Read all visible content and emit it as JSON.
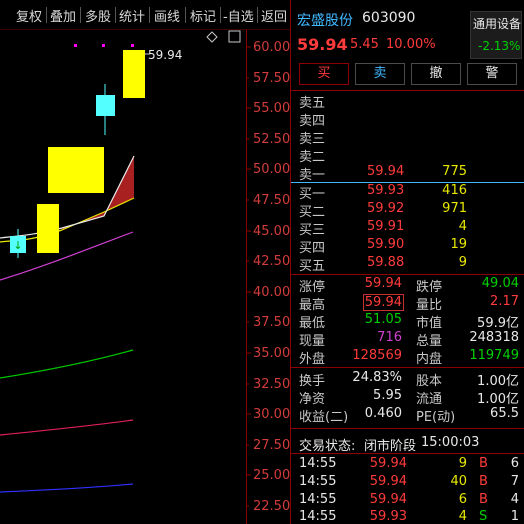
{
  "toolbar": {
    "items": [
      "复权",
      "叠加",
      "多股",
      "统计",
      "画线",
      "标记",
      "-自选",
      "返回"
    ]
  },
  "chart": {
    "y_ticks": [
      "60.00",
      "57.50",
      "55.00",
      "52.50",
      "50.00",
      "47.50",
      "45.00",
      "42.50",
      "40.00",
      "37.50",
      "35.00",
      "32.50",
      "30.00",
      "27.50",
      "25.00",
      "22.50"
    ],
    "last_price_label": "59.94"
  },
  "stock": {
    "name": "宏盛股份",
    "code": "603090",
    "price": "59.94",
    "change": "5.45",
    "change_pct": "10.00%",
    "sector_label": "通用设备",
    "sector_change": "-2.13%"
  },
  "actions": {
    "buy": "买",
    "sell": "卖",
    "cancel": "撤",
    "alert": "警"
  },
  "order_book": {
    "asks": [
      {
        "label": "卖五",
        "price": "",
        "volume": ""
      },
      {
        "label": "卖四",
        "price": "",
        "volume": ""
      },
      {
        "label": "卖三",
        "price": "",
        "volume": ""
      },
      {
        "label": "卖二",
        "price": "",
        "volume": ""
      },
      {
        "label": "卖一",
        "price": "59.94",
        "volume": "775"
      }
    ],
    "bids": [
      {
        "label": "买一",
        "price": "59.93",
        "volume": "416"
      },
      {
        "label": "买二",
        "price": "59.92",
        "volume": "971"
      },
      {
        "label": "买三",
        "price": "59.91",
        "volume": "4"
      },
      {
        "label": "买四",
        "price": "59.90",
        "volume": "19"
      },
      {
        "label": "买五",
        "price": "59.88",
        "volume": "9"
      }
    ]
  },
  "stats": {
    "limit_up_label": "涨停",
    "limit_up": "59.94",
    "limit_down_label": "跌停",
    "limit_down": "49.04",
    "high_label": "最高",
    "high": "59.94",
    "vol_ratio_label": "量比",
    "vol_ratio": "2.17",
    "low_label": "最低",
    "low": "51.05",
    "mkt_cap_label": "市值",
    "mkt_cap": "59.9亿",
    "cur_vol_label": "现量",
    "cur_vol": "716",
    "total_vol_label": "总量",
    "total_vol": "248318",
    "outer_label": "外盘",
    "outer": "128569",
    "inner_label": "内盘",
    "inner": "119749",
    "turnover_label": "换手",
    "turnover": "24.83%",
    "shares_label": "股本",
    "shares": "1.00亿",
    "nav_label": "净资",
    "nav": "5.95",
    "float_label": "流通",
    "float": "1.00亿",
    "eps_label": "收益(二)",
    "eps": "0.460",
    "pe_label": "PE(动)",
    "pe": "65.5"
  },
  "status": {
    "label": "交易状态:",
    "phase": "闭市阶段",
    "time": "15:00:03"
  },
  "ticks": [
    {
      "time": "14:55",
      "price": "59.94",
      "vol": "9",
      "side": "B",
      "count": "6"
    },
    {
      "time": "14:55",
      "price": "59.94",
      "vol": "40",
      "side": "B",
      "count": "7"
    },
    {
      "time": "14:55",
      "price": "59.94",
      "vol": "6",
      "side": "B",
      "count": "4"
    },
    {
      "time": "14:55",
      "price": "59.93",
      "vol": "4",
      "side": "S",
      "count": "1"
    }
  ]
}
